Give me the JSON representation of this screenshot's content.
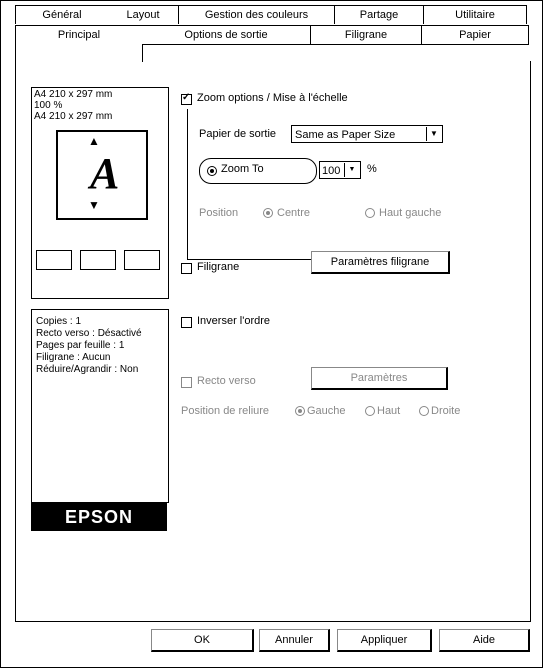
{
  "tabs_row1": [
    "Général",
    "Layout",
    "Gestion des couleurs",
    "Partage",
    "Utilitaire"
  ],
  "tabs_row2": [
    "Principal",
    "Options de sortie",
    "Filigrane",
    "Papier"
  ],
  "preview": {
    "paper_lines": [
      "A4 210 x 297 mm",
      "100 %",
      "A4 210 x 297 mm"
    ],
    "glyph": "A",
    "info_lines": [
      "Copies : 1",
      "Recto verso : Désactivé",
      "Pages par feuille : 1",
      "Filigrane : Aucun",
      "Réduire/Agrandir : Non"
    ],
    "brand": "EPSON"
  },
  "options": {
    "zoom_label": "Zoom options / Mise à l'échelle",
    "output_paper_label": "Papier de sortie",
    "output_paper_value": "Same as Paper Size",
    "zoom_to_label": "Zoom To",
    "zoom_value": "100",
    "zoom_unit": "%",
    "location_label": "Position",
    "center_label": "Centre",
    "upper_left_label": "Haut gauche",
    "watermark_label": "Filigrane",
    "watermark_button": "Paramètres filigrane",
    "reverse_label": "Inverser l'ordre",
    "duplex_label": "Recto verso",
    "duplex_button": "Paramètres",
    "binding_label": "Position de reliure",
    "binding_left": "Gauche",
    "binding_top": "Haut",
    "binding_right": "Droite"
  },
  "footer": {
    "ok": "OK",
    "cancel": "Annuler",
    "apply": "Appliquer",
    "help": "Aide"
  },
  "icons": {
    "arrow_down": "▼",
    "arrow_up": "▲"
  }
}
